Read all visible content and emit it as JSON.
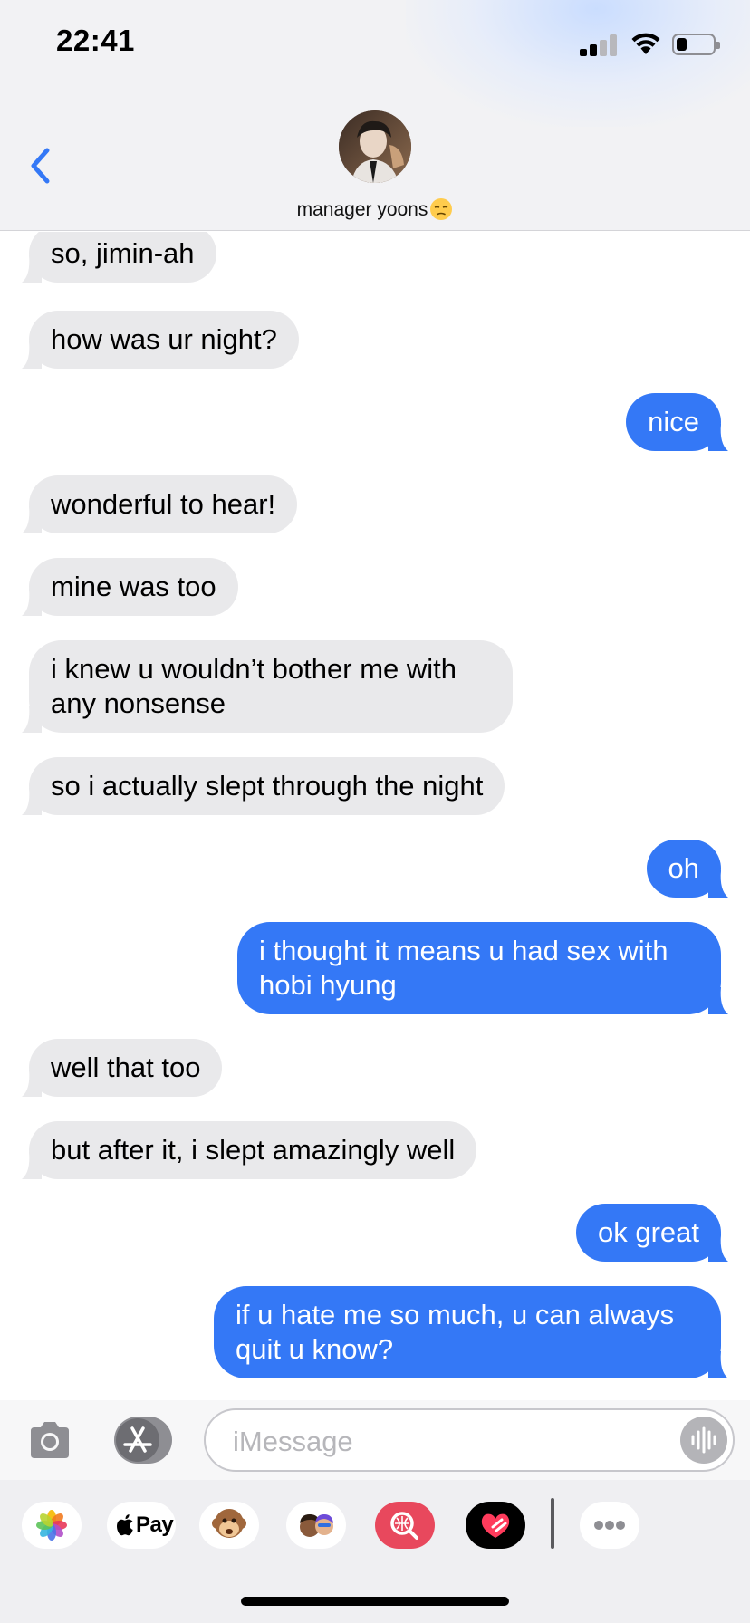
{
  "status_bar": {
    "time": "22:41"
  },
  "header": {
    "contact_name": "manager yoons",
    "contact_emoji": "unamused-face-emoji",
    "back_icon": "chevron-left-icon"
  },
  "messages": [
    {
      "side": "in",
      "text": "so, jimin-ah"
    },
    {
      "side": "in",
      "text": "how was ur night?"
    },
    {
      "side": "out",
      "text": "nice"
    },
    {
      "side": "in",
      "text": "wonderful to hear!"
    },
    {
      "side": "in",
      "text": "mine was too"
    },
    {
      "side": "in",
      "text": "i knew u wouldn’t bother me with any nonsense"
    },
    {
      "side": "in",
      "text": "so i actually slept through the night"
    },
    {
      "side": "out",
      "text": "oh"
    },
    {
      "side": "out",
      "text": "i thought it means u had sex with hobi hyung"
    },
    {
      "side": "in",
      "text": "well that too"
    },
    {
      "side": "in",
      "text": "but after it, i slept amazingly well"
    },
    {
      "side": "out",
      "text": "ok great"
    },
    {
      "side": "out",
      "text": "if u hate me so much, u can always quit u know?"
    }
  ],
  "input": {
    "placeholder": "iMessage"
  },
  "drawer": {
    "apple_pay_label": "Pay",
    "apps": [
      "photos-icon",
      "apple-pay-icon",
      "monkey-animoji-icon",
      "memoji-icon",
      "gif-search-icon",
      "digital-touch-icon",
      "more-apps-icon"
    ]
  },
  "colors": {
    "outgoing_bubble": "#3478f6",
    "incoming_bubble": "#e9e9eb",
    "accent": "#3478f6"
  }
}
